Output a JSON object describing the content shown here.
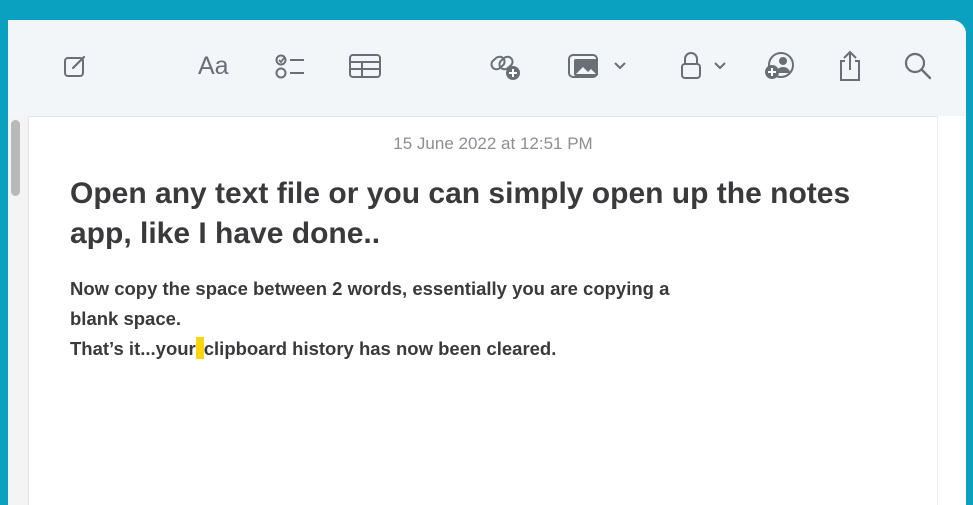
{
  "toolbar": {
    "items": [
      {
        "icon": "compose-icon",
        "label": ""
      },
      {
        "icon": "format-text-icon",
        "label": "Aa"
      },
      {
        "icon": "checklist-icon",
        "label": ""
      },
      {
        "icon": "table-icon",
        "label": ""
      },
      {
        "icon": "collaborate-link-icon",
        "label": ""
      },
      {
        "icon": "media-icon",
        "label": ""
      },
      {
        "icon": "lock-icon",
        "label": ""
      },
      {
        "icon": "share-people-icon",
        "label": ""
      },
      {
        "icon": "share-export-icon",
        "label": ""
      },
      {
        "icon": "search-icon",
        "label": ""
      }
    ]
  },
  "note": {
    "timestamp": "15 June 2022 at 12:51 PM",
    "title": "Open any text file or you can simply open up the notes app, like I have done..",
    "line1": "Now copy the space between 2 words, essentially you are copying a",
    "line2": "blank space.",
    "line3_before": "That’s it...your",
    "line3_after": "clipboard history has now been cleared."
  },
  "colors": {
    "background": "#0aa0bf",
    "toolbar": "#f2f6f9",
    "text": "#3a3a3c",
    "timestamp": "#8e8e93",
    "highlight": "#ffd60a"
  }
}
